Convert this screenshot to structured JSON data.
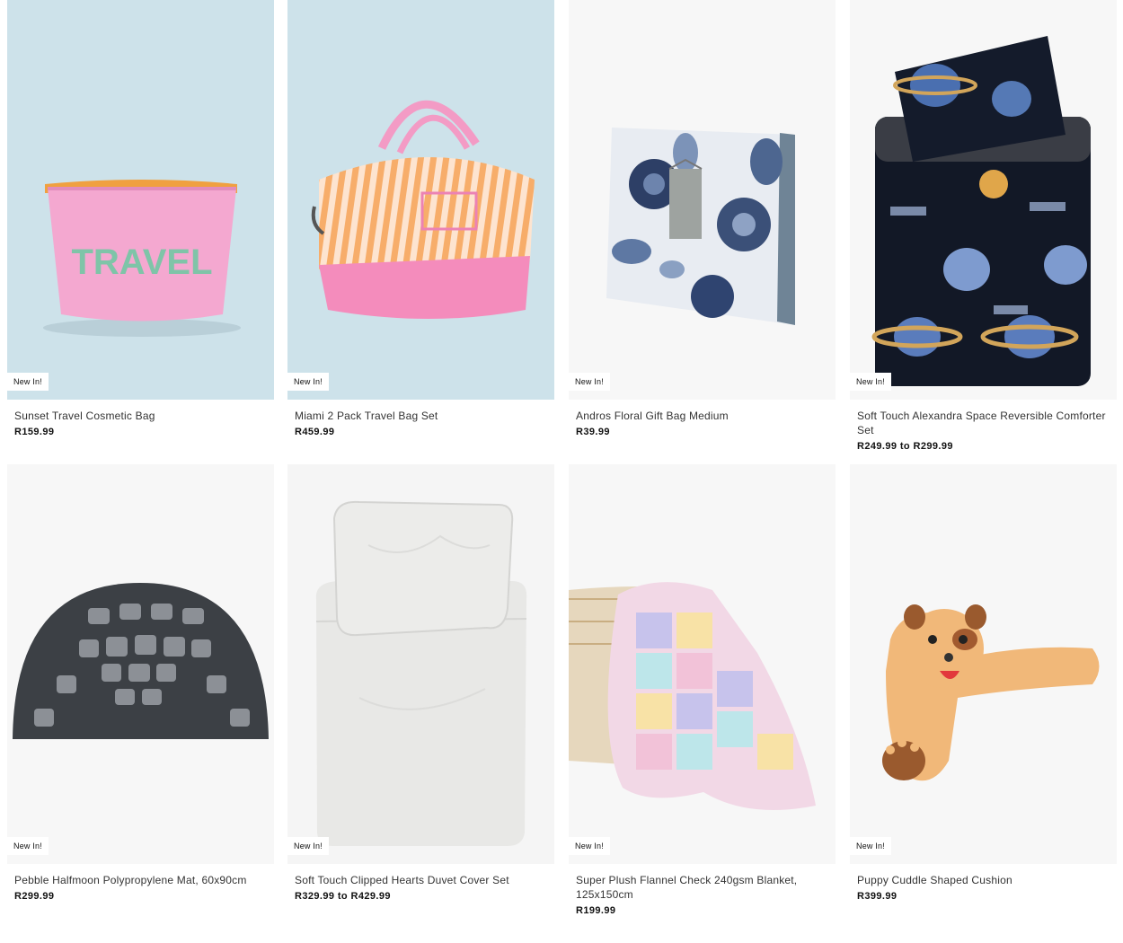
{
  "products": [
    {
      "title": "Sunset Travel Cosmetic Bag",
      "price": "R159.99",
      "badge": "New In!",
      "bag_text": "TRAVEL",
      "image_icon": "cosmetic-bag-icon"
    },
    {
      "title": "Miami 2 Pack Travel Bag Set",
      "price": "R459.99",
      "badge": "New In!",
      "image_icon": "duffel-bag-icon"
    },
    {
      "title": "Andros Floral Gift Bag Medium",
      "price": "R39.99",
      "badge": "New In!",
      "image_icon": "gift-bag-icon"
    },
    {
      "title": "Soft Touch Alexandra Space Reversible Comforter Set",
      "price": "R249.99 to R299.99",
      "badge": "New In!",
      "image_icon": "comforter-icon"
    },
    {
      "title": "Pebble Halfmoon Polypropylene Mat, 60x90cm",
      "price": "R299.99",
      "badge": "New In!",
      "image_icon": "mat-icon"
    },
    {
      "title": "Soft Touch Clipped Hearts Duvet Cover Set",
      "price": "R329.99 to R429.99",
      "badge": "New In!",
      "image_icon": "duvet-icon"
    },
    {
      "title": "Super Plush Flannel Check 240gsm Blanket, 125x150cm",
      "price": "R199.99",
      "badge": "New In!",
      "image_icon": "blanket-icon"
    },
    {
      "title": "Puppy Cuddle Shaped Cushion",
      "price": "R399.99",
      "badge": "New In!",
      "image_icon": "cushion-icon"
    }
  ],
  "colors": {
    "pink": "#f3a6cf",
    "sky": "#c9e1ec",
    "navy": "#1b2340",
    "page": "#ffffff"
  }
}
